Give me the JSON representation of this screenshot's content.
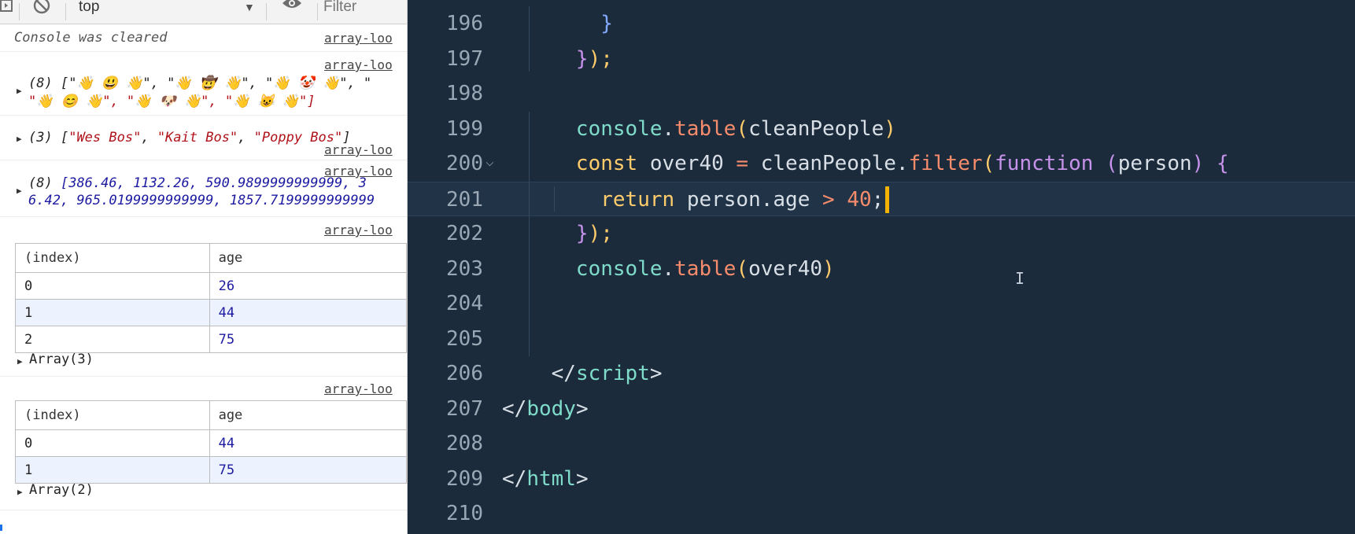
{
  "console": {
    "toolbar": {
      "context": "top",
      "filter_placeholder": "Filter"
    },
    "source_label": "array-loo",
    "cleared_message": "Console was cleared",
    "emoji_array": {
      "count": "(8)",
      "line1": "[\"👋 😃 👋\", \"👋 🤠 👋\", \"👋 🤡 👋\", \"",
      "line2": "\"👋 😊 👋\", \"👋 🐶 👋\", \"👋 😺 👋\"]"
    },
    "names_array": {
      "count": "(3)",
      "items": [
        "\"Wes Bos\"",
        "\"Kait Bos\"",
        "\"Poppy Bos\""
      ]
    },
    "numbers_array": {
      "count": "(8)",
      "line1": "[386.46, 1132.26, 590.9899999999999, 3",
      "line2": "6.42, 965.0199999999999, 1857.7199999999999"
    },
    "table1": {
      "headers": [
        "(index)",
        "age"
      ],
      "rows": [
        [
          "0",
          "26"
        ],
        [
          "1",
          "44"
        ],
        [
          "2",
          "75"
        ]
      ],
      "footer": "Array(3)"
    },
    "table2": {
      "headers": [
        "(index)",
        "age"
      ],
      "rows": [
        [
          "0",
          "44"
        ],
        [
          "1",
          "75"
        ]
      ],
      "footer": "Array(2)"
    }
  },
  "editor": {
    "lines": [
      {
        "n": "196",
        "tokens": [
          [
            "        ",
            "k-white"
          ],
          [
            "}",
            "k-blue"
          ]
        ]
      },
      {
        "n": "197",
        "tokens": [
          [
            "      ",
            "k-white"
          ],
          [
            "}",
            "k-pink"
          ],
          [
            ");",
            "k-yellow"
          ]
        ]
      },
      {
        "n": "198",
        "tokens": []
      },
      {
        "n": "199",
        "tokens": [
          [
            "      ",
            "k-white"
          ],
          [
            "console",
            "k-cyan"
          ],
          [
            ".",
            "k-white"
          ],
          [
            "table",
            "k-orange"
          ],
          [
            "(",
            "k-yellow"
          ],
          [
            "cleanPeople",
            "k-white"
          ],
          [
            ")",
            "k-yellow"
          ]
        ]
      },
      {
        "n": "200",
        "tokens": [
          [
            "      ",
            "k-white"
          ],
          [
            "const ",
            "k-yellow"
          ],
          [
            "over40 ",
            "k-white"
          ],
          [
            "= ",
            "k-orange"
          ],
          [
            "cleanPeople",
            "k-white"
          ],
          [
            ".",
            "k-white"
          ],
          [
            "filter",
            "k-orange"
          ],
          [
            "(",
            "k-yellow"
          ],
          [
            "function ",
            "k-pink"
          ],
          [
            "(",
            "k-pink"
          ],
          [
            "person",
            "k-white"
          ],
          [
            ") ",
            "k-pink"
          ],
          [
            "{",
            "k-pink"
          ]
        ]
      },
      {
        "n": "201",
        "tokens": [
          [
            "        ",
            "k-white"
          ],
          [
            "return ",
            "k-yellow"
          ],
          [
            "person",
            "k-white"
          ],
          [
            ".",
            "k-white"
          ],
          [
            "age ",
            "k-white"
          ],
          [
            "> ",
            "k-orange"
          ],
          [
            "40",
            "k-orange"
          ],
          [
            ";",
            "k-white"
          ]
        ]
      },
      {
        "n": "202",
        "tokens": [
          [
            "      ",
            "k-white"
          ],
          [
            "}",
            "k-pink"
          ],
          [
            ");",
            "k-yellow"
          ]
        ]
      },
      {
        "n": "203",
        "tokens": [
          [
            "      ",
            "k-white"
          ],
          [
            "console",
            "k-cyan"
          ],
          [
            ".",
            "k-white"
          ],
          [
            "table",
            "k-orange"
          ],
          [
            "(",
            "k-yellow"
          ],
          [
            "over40",
            "k-white"
          ],
          [
            ")",
            "k-yellow"
          ]
        ]
      },
      {
        "n": "204",
        "tokens": []
      },
      {
        "n": "205",
        "tokens": []
      },
      {
        "n": "206",
        "tokens": [
          [
            "    ",
            "k-white"
          ],
          [
            "</",
            "k-white"
          ],
          [
            "script",
            "k-cyan"
          ],
          [
            ">",
            "k-white"
          ]
        ]
      },
      {
        "n": "207",
        "tokens": [
          [
            "",
            "k-white"
          ],
          [
            "</",
            "k-white"
          ],
          [
            "body",
            "k-cyan"
          ],
          [
            ">",
            "k-white"
          ]
        ]
      },
      {
        "n": "208",
        "tokens": []
      },
      {
        "n": "209",
        "tokens": [
          [
            "",
            "k-white"
          ],
          [
            "</",
            "k-white"
          ],
          [
            "html",
            "k-cyan"
          ],
          [
            ">",
            "k-white"
          ]
        ]
      },
      {
        "n": "210",
        "tokens": []
      }
    ],
    "active_line": "201",
    "folded_line": "200"
  },
  "colors": {
    "editor_bg": "#1b2b3b",
    "caret": "#f2b400",
    "string_red": "#b0121a",
    "number_blue": "#1c1aa0"
  },
  "icons": [
    "sidebar-toggle-icon",
    "clear-console-icon",
    "context-dropdown-arrow-icon",
    "live-expression-eye-icon",
    "expand-triangle-icon",
    "fold-chevron-icon",
    "text-cursor-icon"
  ]
}
